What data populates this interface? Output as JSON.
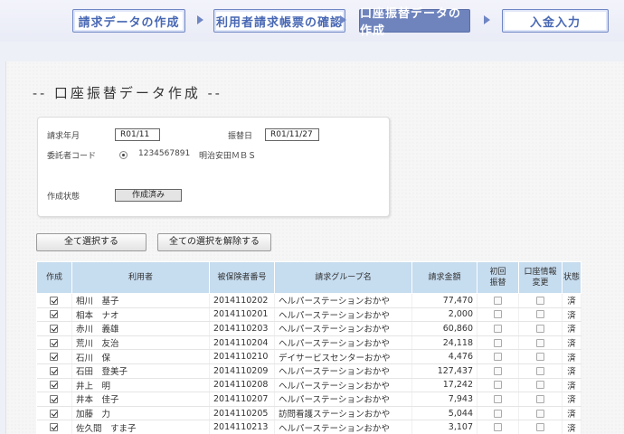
{
  "steps": [
    {
      "label": "請求データの作成",
      "active": false
    },
    {
      "label": "利用者請求帳票の確認",
      "active": false
    },
    {
      "label": "口座振替データの作成",
      "active": true
    },
    {
      "label": "入金入力",
      "active": false
    }
  ],
  "page_title": "-- 口座振替データ作成 --",
  "info": {
    "billing_month_label": "請求年月",
    "billing_month_value": "R01/11",
    "transfer_date_label": "振替日",
    "transfer_date_value": "R01/11/27",
    "consignor_code_label": "委託者コード",
    "consignor_code_value": "1234567891",
    "consignor_name": "明治安田ＭＢＳ",
    "status_label": "作成状態",
    "status_value": "作成済み"
  },
  "buttons": {
    "select_all": "全て選択する",
    "deselect_all": "全ての選択を解除する"
  },
  "table": {
    "headers": {
      "create": "作成",
      "user": "利用者",
      "insured_no": "被保険者番号",
      "billing_group": "請求グループ名",
      "amount": "請求金額",
      "first_transfer_1": "初回",
      "first_transfer_2": "振替",
      "account_change_1": "口座情報",
      "account_change_2": "変更",
      "status": "状態"
    },
    "rows": [
      {
        "checked": true,
        "user": "相川　基子",
        "insured_no": "2014110202",
        "group": "ヘルパーステーションおかや",
        "amount": "77,470",
        "status": "済"
      },
      {
        "checked": true,
        "user": "相本　ナオ",
        "insured_no": "2014110201",
        "group": "ヘルパーステーションおかや",
        "amount": "2,000",
        "status": "済"
      },
      {
        "checked": true,
        "user": "赤川　義雄",
        "insured_no": "2014110203",
        "group": "ヘルパーステーションおかや",
        "amount": "60,860",
        "status": "済"
      },
      {
        "checked": true,
        "user": "荒川　友治",
        "insured_no": "2014110204",
        "group": "ヘルパーステーションおかや",
        "amount": "24,118",
        "status": "済"
      },
      {
        "checked": true,
        "user": "石川　保",
        "insured_no": "2014110210",
        "group": "デイサービスセンターおかや",
        "amount": "4,476",
        "status": "済"
      },
      {
        "checked": true,
        "user": "石田　登美子",
        "insured_no": "2014110209",
        "group": "ヘルパーステーションおかや",
        "amount": "127,437",
        "status": "済"
      },
      {
        "checked": true,
        "user": "井上　明",
        "insured_no": "2014110208",
        "group": "ヘルパーステーションおかや",
        "amount": "17,242",
        "status": "済"
      },
      {
        "checked": true,
        "user": "井本　佳子",
        "insured_no": "2014110207",
        "group": "ヘルパーステーションおかや",
        "amount": "7,943",
        "status": "済"
      },
      {
        "checked": true,
        "user": "加藤　力",
        "insured_no": "2014110205",
        "group": "訪問看護ステーションおかや",
        "amount": "5,044",
        "status": "済"
      },
      {
        "checked": true,
        "user": "佐久間　すま子",
        "insured_no": "2014110213",
        "group": "ヘルパーステーションおかや",
        "amount": "3,107",
        "status": "済"
      }
    ]
  },
  "colors": {
    "step_border": "#6f86c4",
    "step_active_bg": "#6f84bd",
    "table_header_bg": "#c6dcef"
  }
}
